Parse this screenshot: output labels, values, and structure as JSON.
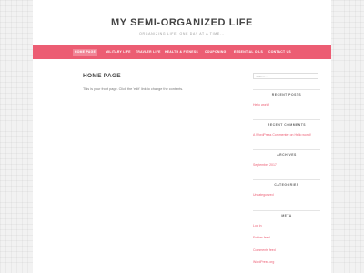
{
  "site": {
    "title": "MY SEMI-ORGANIZED LIFE",
    "tagline": "ORGANIZING LIFE, ONE DAY AT A TIME..."
  },
  "nav": [
    "HOME PAGE",
    "MILITARY LIFE",
    "TRAVLER LIFE",
    "HEALTH & FITNESS",
    "COUPONING",
    "ESSENTIAL OILS",
    "CONTACT US"
  ],
  "main": {
    "heading": "HOME PAGE",
    "text": "This is your front page. Click the 'edit' link to change the contents."
  },
  "sidebar": {
    "search_placeholder": "Search ...",
    "recent_posts": {
      "title": "RECENT POSTS",
      "items": [
        "Hello world!"
      ]
    },
    "recent_comments": {
      "title": "RECENT COMMENTS",
      "items": [
        "A WordPress Commenter on Hello world!"
      ]
    },
    "archives": {
      "title": "ARCHIVES",
      "items": [
        "September 2017"
      ]
    },
    "categories": {
      "title": "CATEGORIES",
      "items": [
        "Uncategorized"
      ]
    },
    "meta": {
      "title": "META",
      "items": [
        "Log in",
        "Entries feed",
        "Comments feed",
        "WordPress.org"
      ]
    }
  },
  "colors": {
    "accent": "#ec5d73",
    "background": "#f2f2f2",
    "text": "#444444"
  }
}
